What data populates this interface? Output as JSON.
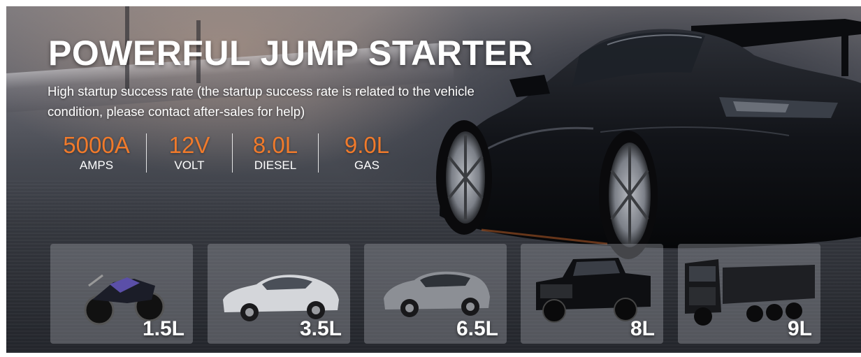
{
  "headline": "POWERFUL JUMP STARTER",
  "subtext": "High startup success rate (the startup success rate is related to the vehicle condition, please contact after-sales for help)",
  "stats": [
    {
      "value": "5000A",
      "unit": "AMPS"
    },
    {
      "value": "12V",
      "unit": "VOLT"
    },
    {
      "value": "8.0L",
      "unit": "DIESEL"
    },
    {
      "value": "9.0L",
      "unit": "GAS"
    }
  ],
  "vehicles": [
    {
      "icon": "motorcycle-icon",
      "label": "1.5L"
    },
    {
      "icon": "sedan-icon",
      "label": "3.5L"
    },
    {
      "icon": "suv-icon",
      "label": "6.5L"
    },
    {
      "icon": "pickup-truck-icon",
      "label": "8L"
    },
    {
      "icon": "dump-truck-icon",
      "label": "9L"
    }
  ],
  "colors": {
    "accent": "#f07a2b",
    "text": "#ffffff"
  }
}
